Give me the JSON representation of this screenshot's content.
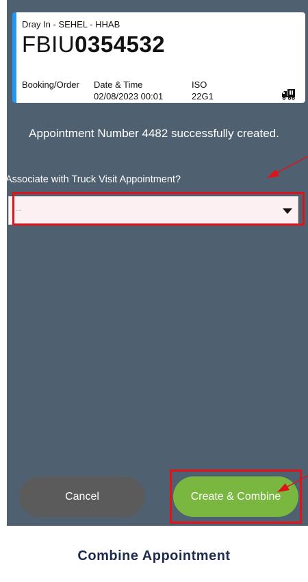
{
  "card": {
    "subtitle": "Dray In - SEHEL - HHAB",
    "container_prefix": "FBIU",
    "container_number": "0354532",
    "booking_label": "Booking/Order",
    "datetime_label": "Date & Time",
    "datetime_value": "02/08/2023 00:01",
    "iso_label": "ISO",
    "iso_value": "22G1",
    "truck_icon": "truck-icon"
  },
  "message": "Appointment Number 4482 successfully created.",
  "question": "Associate with Truck Visit Appointment?",
  "select": {
    "value": "--"
  },
  "buttons": {
    "cancel": "Cancel",
    "create": "Create & Combine"
  },
  "caption": "Combine Appointment",
  "colors": {
    "accent": "#2196f3",
    "highlight": "#e0131b",
    "primary_button": "#79b741",
    "background": "#4f6071"
  }
}
